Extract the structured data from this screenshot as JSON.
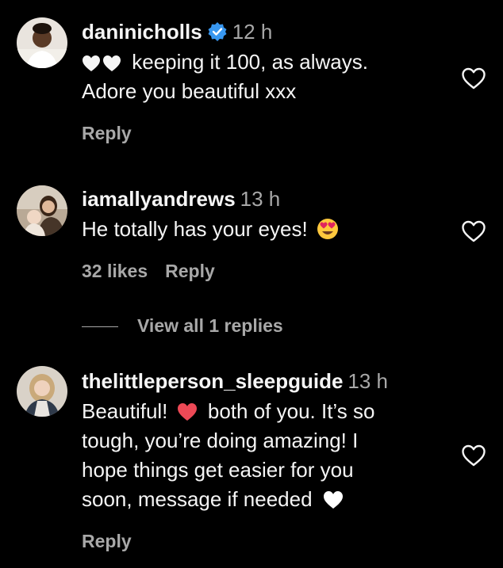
{
  "comments": [
    {
      "username": "daninicholls",
      "verified": true,
      "time": "12 h",
      "lines": [
        "keeping it 100, as always.",
        "Adore you beautiful xxx"
      ],
      "likes": "",
      "reply_label": "Reply"
    },
    {
      "username": "iamallyandrews",
      "verified": false,
      "time": "13 h",
      "lines": [
        "He totally has your eyes!"
      ],
      "likes": "32 likes",
      "reply_label": "Reply",
      "view_replies": "View all 1 replies"
    },
    {
      "username": "thelittleperson_sleepguide",
      "verified": false,
      "time": "13 h",
      "lines": [
        "Beautiful!",
        "both of you. It’s so",
        "tough, you’re doing amazing! I",
        "hope things get easier for you",
        "soon, message if needed"
      ],
      "likes": "",
      "reply_label": "Reply"
    }
  ],
  "icons": {
    "verified": "verified-badge-icon",
    "like": "heart-outline-icon",
    "heart_emoji": "heart-emoji",
    "heart_eyes": "heart-eyes-emoji",
    "white_heart": "white-heart-emoji"
  },
  "colors": {
    "background": "#000000",
    "text": "#f5f5f5",
    "muted": "#a8a8a8",
    "verified_blue": "#3897f0",
    "red_heart": "#ed4956"
  }
}
